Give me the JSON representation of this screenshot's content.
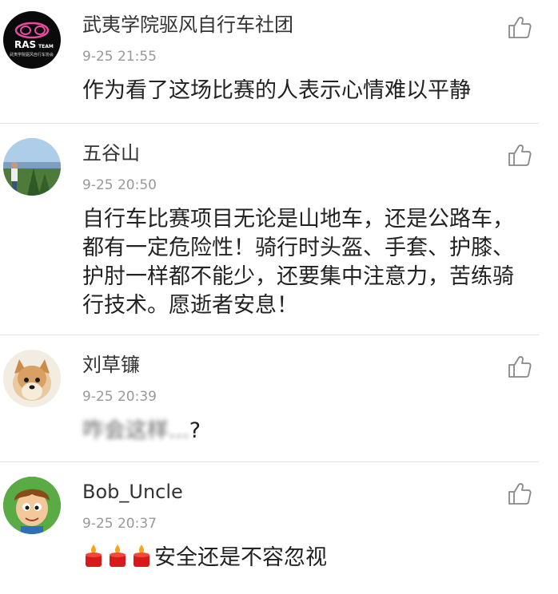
{
  "comments": [
    {
      "author": "武夷学院驱风自行车社团",
      "time": "9-25 21:55",
      "text": "作为看了这场比赛的人表示心情难以平静",
      "avatar_text": "RAS",
      "avatar_team": "TEAM",
      "avatar_sub": "武夷学院驱风自行车协会",
      "like_icon": "thumbs-up-icon"
    },
    {
      "author": "五谷山",
      "time": "9-25 20:50",
      "text": "自行车比赛项目无论是山地车，还是公路车，都有一定危险性！骑行时头盔、手套、护膝、护肘一样都不能少，还要集中注意力，苦练骑行技术。愿逝者安息！",
      "like_icon": "thumbs-up-icon"
    },
    {
      "author": "刘草镰",
      "time": "9-25 20:39",
      "text_blurred": "咋会这样...",
      "text_tail": "?",
      "like_icon": "thumbs-up-icon"
    },
    {
      "author": "Bob_Uncle",
      "time": "9-25 20:37",
      "emoji": "candle-emoji",
      "text": "安全还是不容忽视",
      "like_icon": "thumbs-up-icon"
    }
  ],
  "colors": {
    "author": "#333333",
    "time": "#999999",
    "body": "#222222",
    "separator": "#e3e3e3",
    "candle": "#d91a1a"
  }
}
